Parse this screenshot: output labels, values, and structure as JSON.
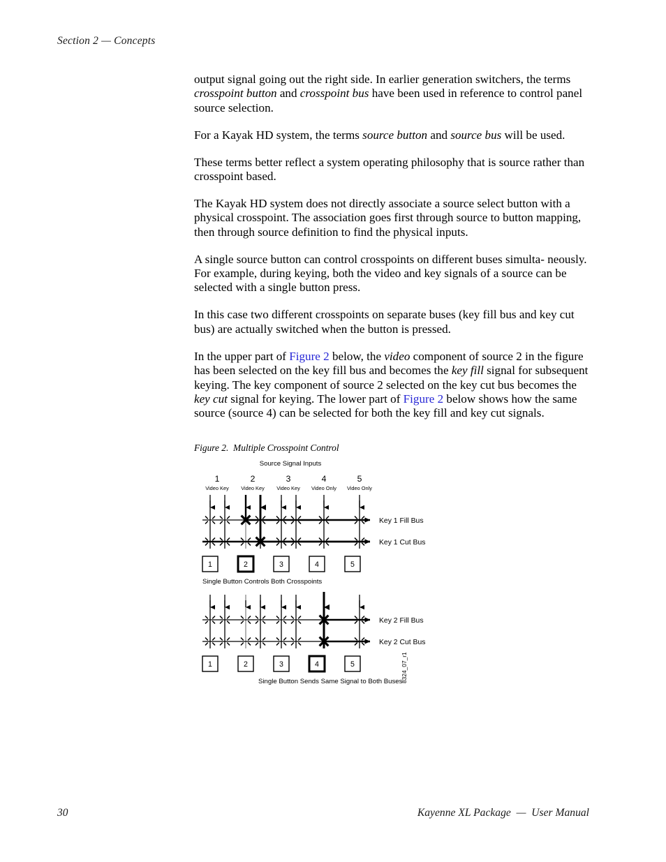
{
  "page": {
    "running_head": "Section 2 — Concepts",
    "folio": "30",
    "footer_title": "Kayenne XL Package  —  User Manual"
  },
  "paragraphs": [
    {
      "id": "p1",
      "runs": [
        {
          "text": "output signal going out the right side. In earlier generation switchers, the terms ",
          "style": "roman"
        },
        {
          "text": "crosspoint button",
          "style": "italic"
        },
        {
          "text": " and ",
          "style": "roman"
        },
        {
          "text": "crosspoint bus",
          "style": "italic"
        },
        {
          "text": " have been used in reference to control panel source selection.",
          "style": "roman"
        }
      ]
    },
    {
      "id": "p2",
      "runs": [
        {
          "text": "For a Kayak HD system, the terms ",
          "style": "roman"
        },
        {
          "text": "source button",
          "style": "italic"
        },
        {
          "text": " and ",
          "style": "roman"
        },
        {
          "text": "source bus",
          "style": "italic"
        },
        {
          "text": " will be used.",
          "style": "roman"
        }
      ]
    },
    {
      "id": "p3",
      "runs": [
        {
          "text": "These terms better reflect a system operating philosophy that is source rather than crosspoint based.",
          "style": "roman"
        }
      ]
    },
    {
      "id": "p4",
      "runs": [
        {
          "text": "The Kayak HD system does not directly associate a source select button with a physical crosspoint. The association goes first through source to button mapping, then through source definition to find the physical inputs.",
          "style": "roman"
        }
      ]
    },
    {
      "id": "p5",
      "runs": [
        {
          "text": "A single source button can control crosspoints on different buses simultaneously. For example, during keying, both the video and key signals of a source can be selected with a single button press.",
          "style": "roman"
        }
      ]
    },
    {
      "id": "p6",
      "runs": [
        {
          "text": "In this case two different crosspoints on separate buses (key fill bus and key cut bus) are actually switched when the button is pressed.",
          "style": "roman"
        }
      ]
    },
    {
      "id": "p7",
      "runs": [
        {
          "text": "In the upper part of ",
          "style": "roman"
        },
        {
          "text": "Figure 2",
          "style": "xref"
        },
        {
          "text": " below, the ",
          "style": "roman"
        },
        {
          "text": "video",
          "style": "italic"
        },
        {
          "text": " component of source 2 in the figure has been selected on the key fill bus and becomes the ",
          "style": "roman"
        },
        {
          "text": "key fill",
          "style": "italic"
        },
        {
          "text": " signal for subsequent keying. The key component of source 2 selected on the key cut bus becomes the ",
          "style": "roman"
        },
        {
          "text": "key cut",
          "style": "italic"
        },
        {
          "text": " signal for keying. The lower part of ",
          "style": "roman"
        },
        {
          "text": "Figure 2",
          "style": "xref"
        },
        {
          "text": " below shows how the same source (source 4) can be selected for both the key fill and key cut signals.",
          "style": "roman"
        }
      ]
    }
  ],
  "figure": {
    "caption": "Figure 2.  Multiple Crosspoint Control",
    "art_code": "8324_07_r1",
    "header_title": "Source Signal Inputs",
    "sources": [
      {
        "number": "1",
        "sublabel": "Video  Key",
        "inputs": [
          "Video",
          "Key"
        ]
      },
      {
        "number": "2",
        "sublabel": "Video  Key",
        "inputs": [
          "Video",
          "Key"
        ]
      },
      {
        "number": "3",
        "sublabel": "Video  Key",
        "inputs": [
          "Video",
          "Key"
        ]
      },
      {
        "number": "4",
        "sublabel": "Video Only",
        "inputs": [
          "Video"
        ]
      },
      {
        "number": "5",
        "sublabel": "Video Only",
        "inputs": [
          "Video"
        ]
      }
    ],
    "upper": {
      "bus_labels": [
        "Key 1 Fill Bus",
        "Key 1 Cut Bus"
      ],
      "buttons": [
        "1",
        "2",
        "3",
        "4",
        "5"
      ],
      "selected_button": "2",
      "caption": "Single Button Controls Both Crosspoints",
      "closed_crosspoints": [
        {
          "bus": "Key 1 Fill Bus",
          "source": "2",
          "signal": "Video"
        },
        {
          "bus": "Key 1 Cut Bus",
          "source": "2",
          "signal": "Key"
        }
      ]
    },
    "lower": {
      "bus_labels": [
        "Key 2 Fill Bus",
        "Key 2 Cut Bus"
      ],
      "buttons": [
        "1",
        "2",
        "3",
        "4",
        "5"
      ],
      "selected_button": "4",
      "caption": "Single Button Sends Same Signal to Both Buses",
      "closed_crosspoints": [
        {
          "bus": "Key 2 Fill Bus",
          "source": "4",
          "signal": "Video"
        },
        {
          "bus": "Key 2 Cut Bus",
          "source": "4",
          "signal": "Video"
        }
      ]
    }
  },
  "colors": {
    "text": "#000000",
    "xref": "#2626d6",
    "running_head": "#1a1a1a",
    "paper": "#ffffff"
  }
}
